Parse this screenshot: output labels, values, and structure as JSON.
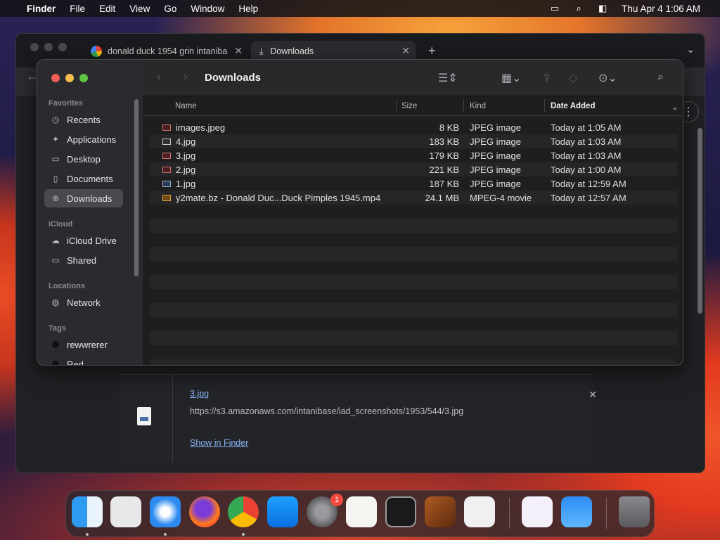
{
  "menubar": {
    "apple": "",
    "app": "Finder",
    "items": [
      "File",
      "Edit",
      "View",
      "Go",
      "Window",
      "Help"
    ],
    "datetime": "Thu Apr 4  1:06 AM",
    "icons": [
      "screen-mirror-icon",
      "search-icon",
      "control-center-icon"
    ]
  },
  "chrome": {
    "tabs": [
      {
        "title": "donald duck 1954 grin intaniba"
      },
      {
        "title": "Downloads"
      }
    ],
    "new_tab": "+",
    "tab_menu": "⌄",
    "kebab": "⋮"
  },
  "download": {
    "file": "3.jpg",
    "url": "https://s3.amazonaws.com/intanibase/iad_screenshots/1953/544/3.jpg",
    "show": "Show in Finder",
    "close": "✕"
  },
  "finder": {
    "title": "Downloads",
    "sidebar": {
      "favorites_label": "Favorites",
      "favorites": [
        "Recents",
        "Applications",
        "Desktop",
        "Documents",
        "Downloads"
      ],
      "icloud_label": "iCloud",
      "icloud": [
        "iCloud Drive",
        "Shared"
      ],
      "locations_label": "Locations",
      "locations": [
        "Network"
      ],
      "tags_label": "Tags",
      "tags": [
        "rewwrerer",
        "Red"
      ]
    },
    "columns": {
      "name": "Name",
      "size": "Size",
      "kind": "Kind",
      "date": "Date Added"
    },
    "files": [
      {
        "name": "images.jpeg",
        "size": "8 KB",
        "kind": "JPEG image",
        "date": "Today at 1:05 AM"
      },
      {
        "name": "4.jpg",
        "size": "183 KB",
        "kind": "JPEG image",
        "date": "Today at 1:03 AM"
      },
      {
        "name": "3.jpg",
        "size": "179 KB",
        "kind": "JPEG image",
        "date": "Today at 1:03 AM"
      },
      {
        "name": "2.jpg",
        "size": "221 KB",
        "kind": "JPEG image",
        "date": "Today at 1:00 AM"
      },
      {
        "name": "1.jpg",
        "size": "187 KB",
        "kind": "JPEG image",
        "date": "Today at 12:59 AM"
      },
      {
        "name": "y2mate.bz - Donald Duc...Duck Pimples 1945.mp4",
        "size": "24.1 MB",
        "kind": "MPEG-4 movie",
        "date": "Today at 12:57 AM"
      }
    ]
  },
  "dock": {
    "apps": [
      "finder-icon",
      "launchpad-icon",
      "safari-icon",
      "firefox-icon",
      "chrome-icon",
      "app-store-icon",
      "system-settings-icon",
      "textedit-icon",
      "terminal-icon",
      "garageband-icon",
      "vscode-icon",
      "visual-studio-icon",
      "weather-icon",
      "trash-icon"
    ],
    "badge": "1"
  }
}
